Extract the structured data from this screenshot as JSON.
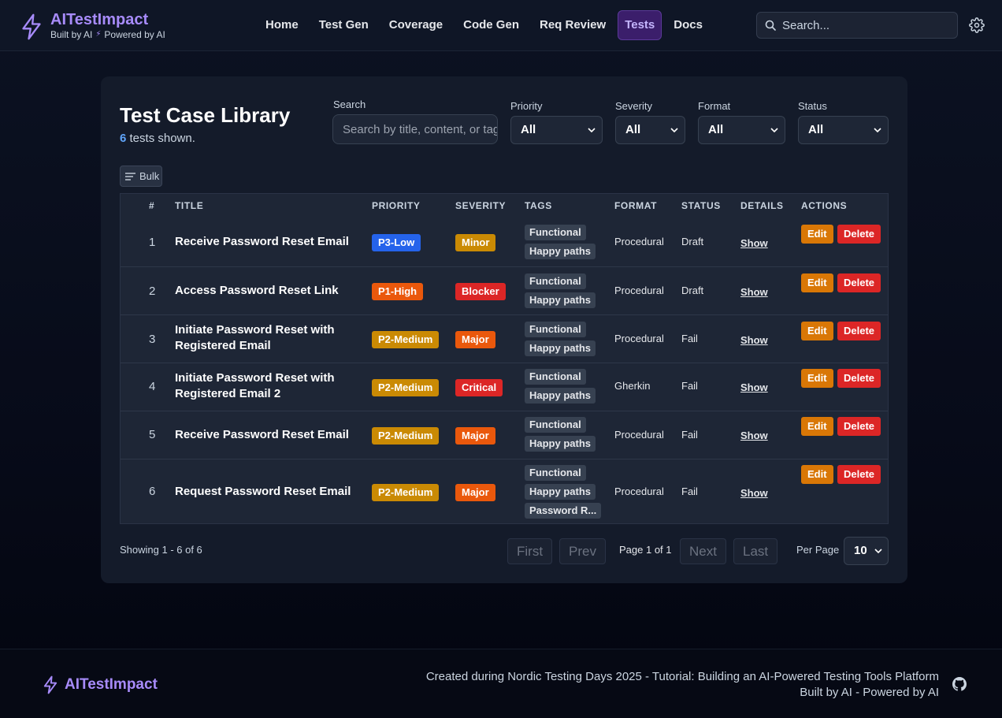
{
  "header": {
    "brand_title": "AITestImpact",
    "brand_sub_left": "Built by AI",
    "brand_sub_right": "Powered by AI",
    "nav": [
      "Home",
      "Test Gen",
      "Coverage",
      "Code Gen",
      "Req Review",
      "Tests",
      "Docs"
    ],
    "active_nav": "Tests",
    "search_placeholder": "Search..."
  },
  "page": {
    "title": "Test Case Library",
    "count": "6",
    "count_suffix": " tests shown.",
    "bulk_label": "Bulk"
  },
  "filters": {
    "search_label": "Search",
    "search_placeholder": "Search by title, content, or tags",
    "priority_label": "Priority",
    "priority_value": "All",
    "severity_label": "Severity",
    "severity_value": "All",
    "format_label": "Format",
    "format_value": "All",
    "status_label": "Status",
    "status_value": "All"
  },
  "table": {
    "headers": [
      "#",
      "TITLE",
      "PRIORITY",
      "SEVERITY",
      "TAGS",
      "FORMAT",
      "STATUS",
      "DETAILS",
      "ACTIONS"
    ],
    "show_label": "Show",
    "edit_label": "Edit",
    "delete_label": "Delete",
    "rows": [
      {
        "idx": "1",
        "title": "Receive Password Reset Email",
        "priority": "P3-Low",
        "severity": "Minor",
        "tags": [
          "Functional",
          "Happy paths"
        ],
        "format": "Procedural",
        "status": "Draft"
      },
      {
        "idx": "2",
        "title": "Access Password Reset Link",
        "priority": "P1-High",
        "severity": "Blocker",
        "tags": [
          "Functional",
          "Happy paths"
        ],
        "format": "Procedural",
        "status": "Draft"
      },
      {
        "idx": "3",
        "title": "Initiate Password Reset with Registered Email",
        "priority": "P2-Medium",
        "severity": "Major",
        "tags": [
          "Functional",
          "Happy paths"
        ],
        "format": "Procedural",
        "status": "Fail"
      },
      {
        "idx": "4",
        "title": "Initiate Password Reset with Registered Email 2",
        "priority": "P2-Medium",
        "severity": "Critical",
        "tags": [
          "Functional",
          "Happy paths"
        ],
        "format": "Gherkin",
        "status": "Fail"
      },
      {
        "idx": "5",
        "title": "Receive Password Reset Email",
        "priority": "P2-Medium",
        "severity": "Major",
        "tags": [
          "Functional",
          "Happy paths"
        ],
        "format": "Procedural",
        "status": "Fail"
      },
      {
        "idx": "6",
        "title": "Request Password Reset Email",
        "priority": "P2-Medium",
        "severity": "Major",
        "tags": [
          "Functional",
          "Happy paths",
          "Password R..."
        ],
        "format": "Procedural",
        "status": "Fail"
      }
    ]
  },
  "colors": {
    "P3-Low": "#2563eb",
    "P1-High": "#ea580c",
    "P2-Medium": "#ca8a04",
    "Minor": "#ca8a04",
    "Blocker": "#dc2626",
    "Major": "#ea580c",
    "Critical": "#dc2626"
  },
  "pagination": {
    "showing": "Showing 1 - 6 of 6",
    "first": "First",
    "prev": "Prev",
    "page_info": "Page 1 of 1",
    "next": "Next",
    "last": "Last",
    "per_page_label": "Per Page",
    "per_page_value": "10"
  },
  "footer": {
    "brand": "AITestImpact",
    "line1": "Created during Nordic Testing Days 2025 - Tutorial: Building an AI-Powered Testing Tools Platform",
    "line2": "Built by AI - Powered by AI"
  }
}
